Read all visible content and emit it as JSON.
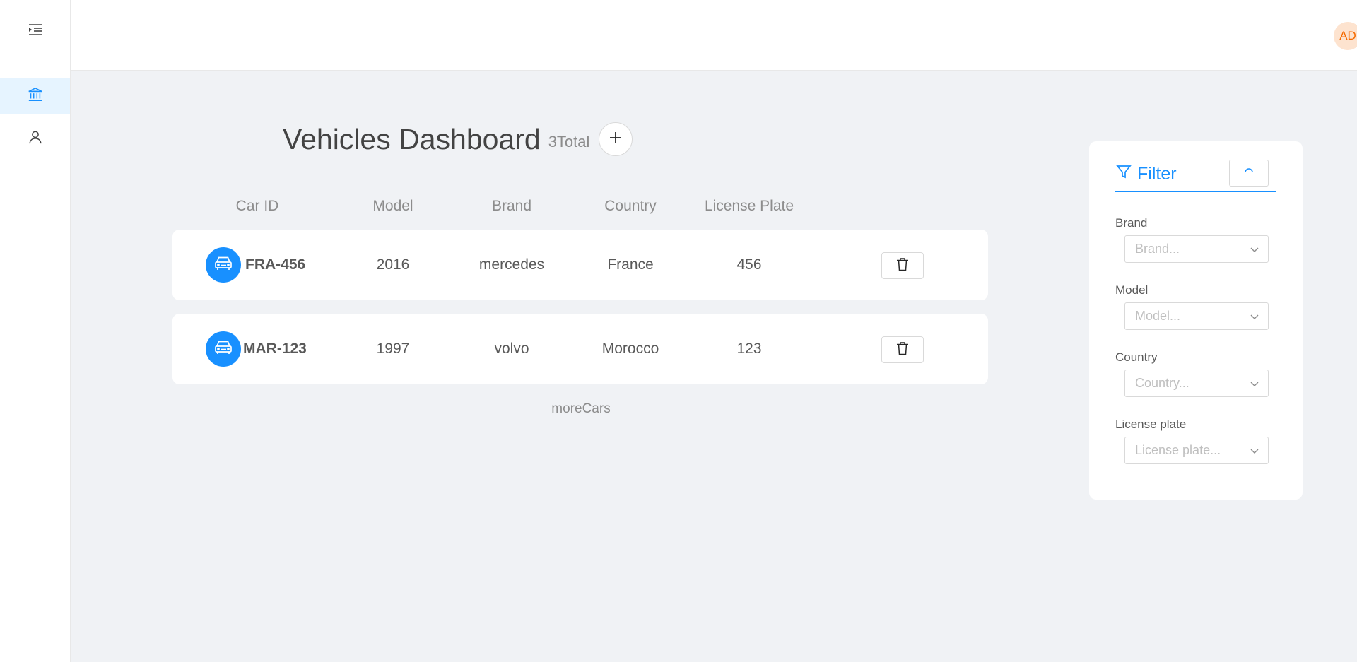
{
  "header": {
    "avatar_initials": "AD"
  },
  "sidebar": {
    "toggle_icon": "menu-unfold-icon",
    "items": [
      {
        "icon": "bank-icon",
        "active": true
      },
      {
        "icon": "user-icon",
        "active": false
      }
    ]
  },
  "dashboard": {
    "title": "Vehicles Dashboard",
    "total": "3Total",
    "add_icon": "plus-icon"
  },
  "table": {
    "columns": [
      "Car ID",
      "Model",
      "Brand",
      "Country",
      "License Plate"
    ],
    "rows": [
      {
        "car_id": "FRA-456",
        "model": "2016",
        "brand": "mercedes",
        "country": "France",
        "license_plate": "456"
      },
      {
        "car_id": "MAR-123",
        "model": "1997",
        "brand": "volvo",
        "country": "Morocco",
        "license_plate": "123"
      }
    ],
    "more_label": "moreCars"
  },
  "filter": {
    "title": "Filter",
    "fields": [
      {
        "label": "Brand",
        "placeholder": "Brand..."
      },
      {
        "label": "Model",
        "placeholder": "Model..."
      },
      {
        "label": "Country",
        "placeholder": "Country..."
      },
      {
        "label": "License plate",
        "placeholder": "License plate..."
      }
    ]
  },
  "colors": {
    "accent": "#1890ff",
    "avatar_bg": "#fde3cf",
    "avatar_fg": "#f56a00",
    "background": "#f0f2f5"
  }
}
